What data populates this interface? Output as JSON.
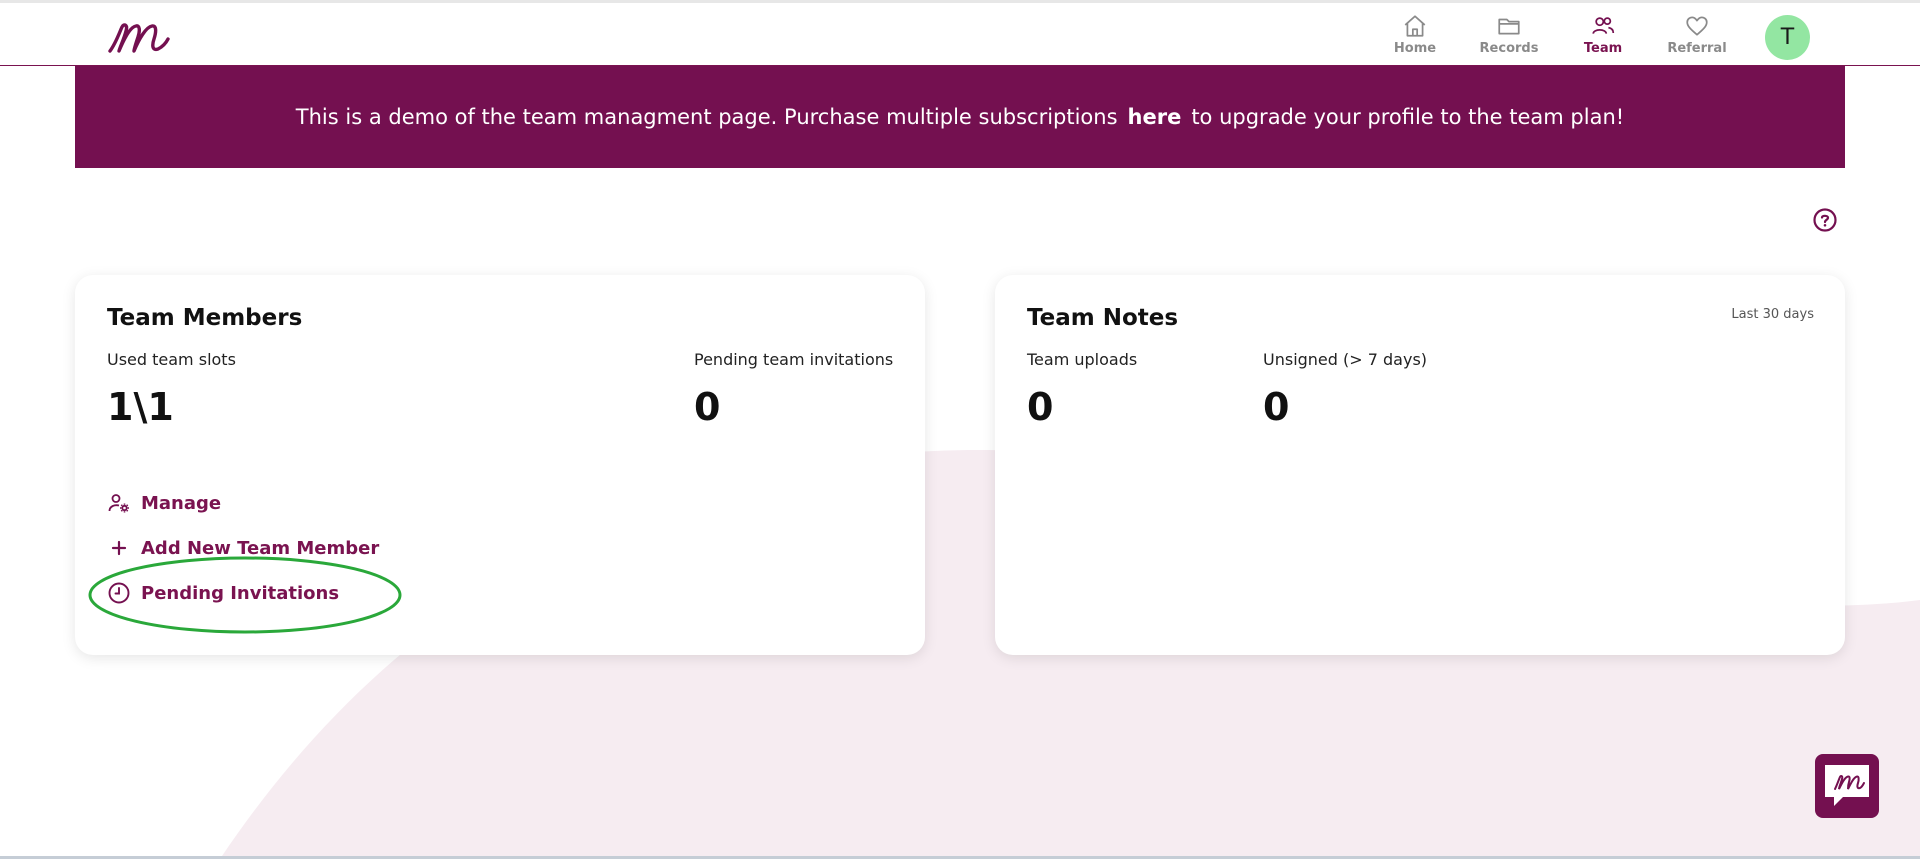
{
  "brand": {
    "accent": "#741050",
    "avatar_color": "#93e6a2",
    "highlight_color": "#2aa83a"
  },
  "nav": {
    "items": [
      {
        "label": "Home",
        "icon": "home-icon",
        "active": false
      },
      {
        "label": "Records",
        "icon": "folder-icon",
        "active": false
      },
      {
        "label": "Team",
        "icon": "users-icon",
        "active": true
      },
      {
        "label": "Referral",
        "icon": "heart-icon",
        "active": false
      }
    ],
    "avatar_initial": "T"
  },
  "banner": {
    "text_before": "This is a demo of the team managment page. Purchase multiple subscriptions",
    "link": "here",
    "text_after": "to upgrade your profile to the team plan!"
  },
  "team_members": {
    "title": "Team Members",
    "used_slots_label": "Used team slots",
    "used_slots_value": "1\\1",
    "pending_label": "Pending team invitations",
    "pending_value": "0",
    "actions": {
      "manage": "Manage",
      "add": "Add New Team Member",
      "pending": "Pending Invitations"
    }
  },
  "team_notes": {
    "title": "Team Notes",
    "range": "Last 30 days",
    "uploads_label": "Team uploads",
    "uploads_value": "0",
    "unsigned_label": "Unsigned (> 7 days)",
    "unsigned_value": "0"
  }
}
